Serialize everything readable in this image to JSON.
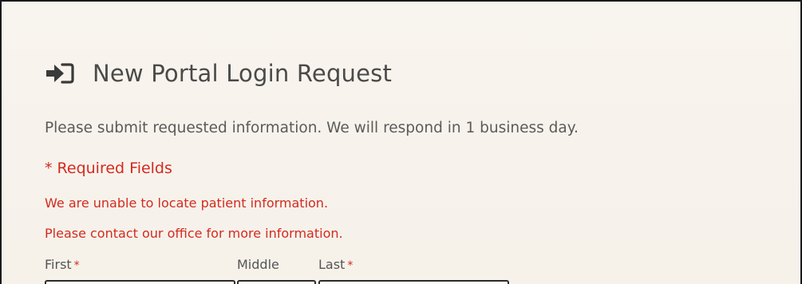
{
  "header": {
    "title": "New Portal Login Request",
    "icon": "sign-in-icon"
  },
  "intro": "Please submit requested information. We will respond in 1 business day.",
  "required_note": "* Required Fields",
  "errors": [
    "We are unable to locate patient information.",
    "Please contact our office for more information."
  ],
  "form": {
    "first": {
      "label": "First",
      "required_mark": "*",
      "value": ""
    },
    "middle": {
      "label": "Middle",
      "value": ""
    },
    "last": {
      "label": "Last",
      "required_mark": "*",
      "value": ""
    }
  },
  "colors": {
    "background": "#f7f3ec",
    "text": "#4a4a4a",
    "error": "#d42a1f",
    "border": "#1a1a1a"
  }
}
